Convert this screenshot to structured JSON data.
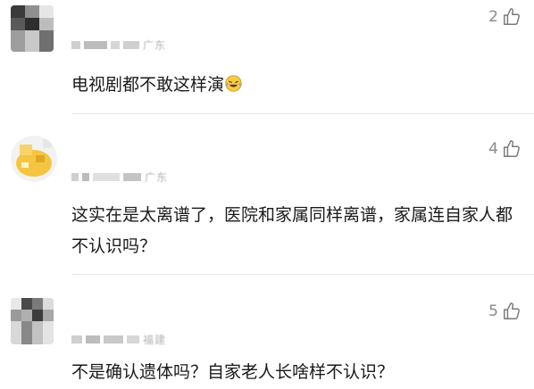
{
  "comments": [
    {
      "location": "广东",
      "likes": "2",
      "text": "电视剧都不敢这样演",
      "emoji_icon": "laughing-tears-emoji-icon"
    },
    {
      "location": "广东",
      "likes": "4",
      "text": "这实在是太离谱了，医院和家属同样离谱，家属连自家人都不认识吗？"
    },
    {
      "location": "福建",
      "likes": "5",
      "text": "不是确认遗体吗？自家老人长啥样不认识？"
    }
  ],
  "colors": {
    "text": "#1a1a1a",
    "muted": "#8a8a8a",
    "divider": "#e8e8e8"
  }
}
